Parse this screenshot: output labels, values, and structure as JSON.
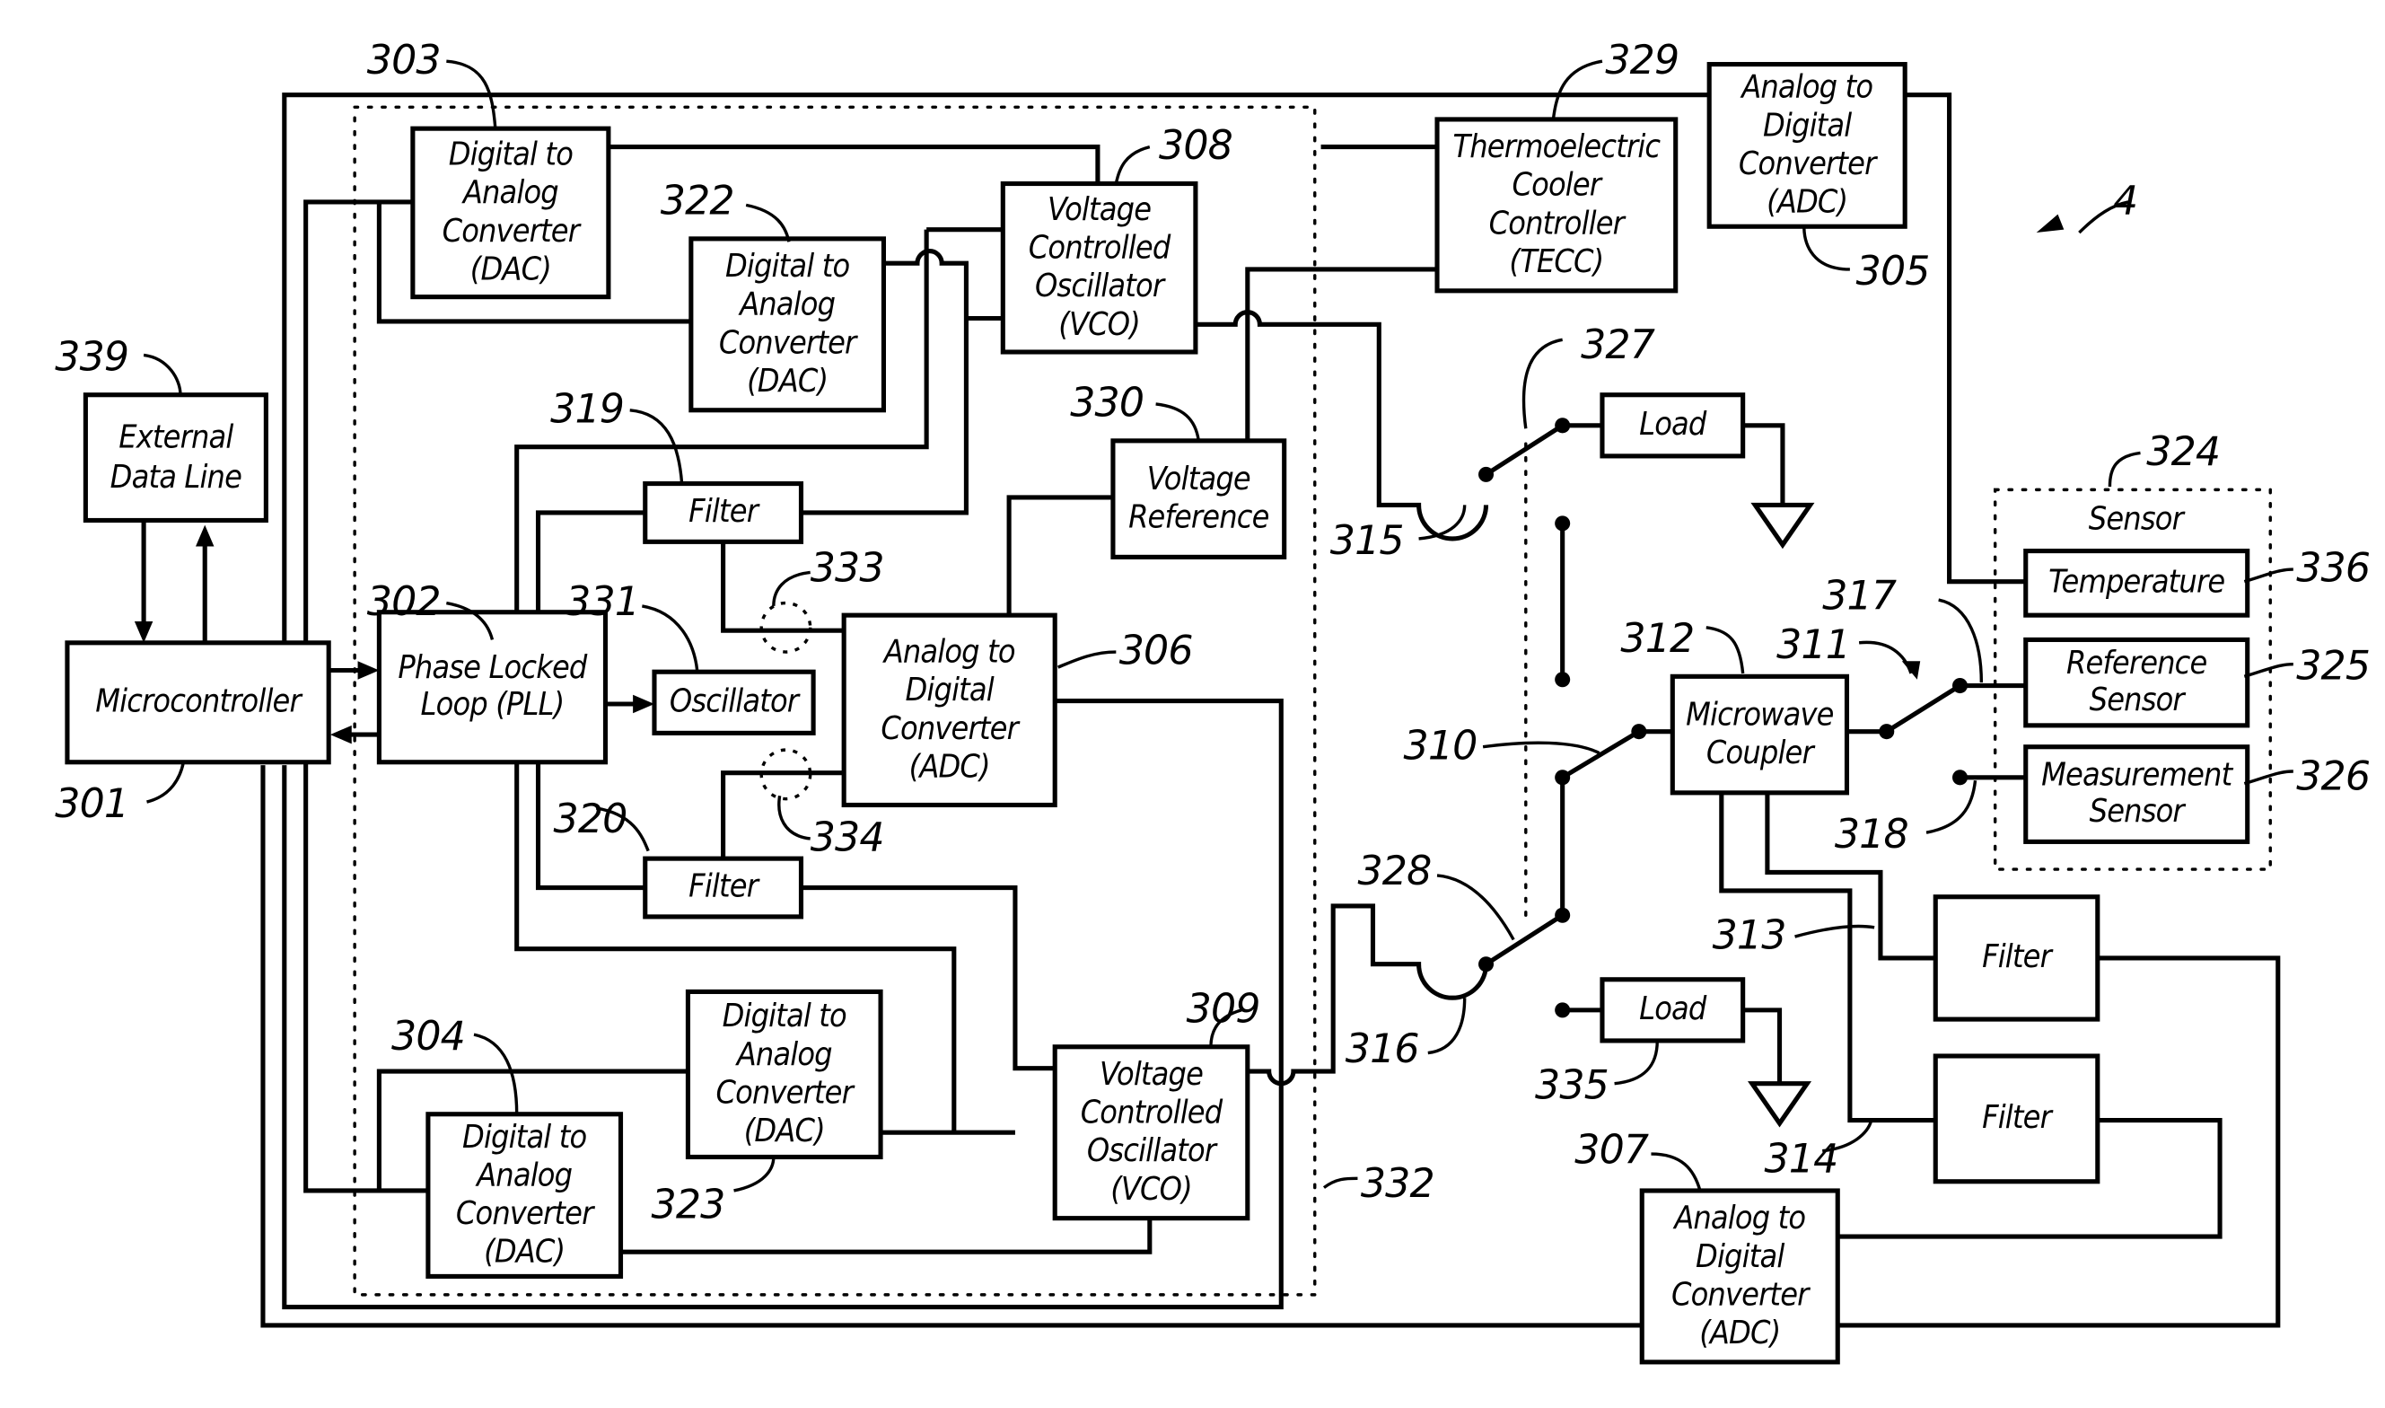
{
  "figure": {
    "figure_number": "4",
    "blocks": {
      "microcontroller": {
        "ref": "301",
        "lines": [
          "Microcontroller"
        ]
      },
      "pll": {
        "ref": "302",
        "lines": [
          "Phase Locked",
          "Loop (PLL)"
        ]
      },
      "dac_303": {
        "ref": "303",
        "lines": [
          "Digital to",
          "Analog",
          "Converter",
          "(DAC)"
        ]
      },
      "dac_322": {
        "ref": "322",
        "lines": [
          "Digital to",
          "Analog",
          "Converter",
          "(DAC)"
        ]
      },
      "dac_304": {
        "ref": "304",
        "lines": [
          "Digital to",
          "Analog",
          "Converter",
          "(DAC)"
        ]
      },
      "dac_323": {
        "ref": "323",
        "lines": [
          "Digital to",
          "Analog",
          "Converter",
          "(DAC)"
        ]
      },
      "vco_308": {
        "ref": "308",
        "lines": [
          "Voltage",
          "Controlled",
          "Oscillator",
          "(VCO)"
        ]
      },
      "vco_309": {
        "ref": "309",
        "lines": [
          "Voltage",
          "Controlled",
          "Oscillator",
          "(VCO)"
        ]
      },
      "filter_319": {
        "ref": "319",
        "lines": [
          "Filter"
        ]
      },
      "filter_320": {
        "ref": "320",
        "lines": [
          "Filter"
        ]
      },
      "oscillator": {
        "ref": "331",
        "lines": [
          "Oscillator"
        ]
      },
      "adc_306": {
        "ref": "306",
        "lines": [
          "Analog to",
          "Digital",
          "Converter",
          "(ADC)"
        ]
      },
      "voltage_reference": {
        "ref": "330",
        "lines": [
          "Voltage",
          "Reference"
        ]
      },
      "tecc": {
        "ref": "329",
        "lines": [
          "Thermoelectric",
          "Cooler",
          "Controller",
          "(TECC)"
        ]
      },
      "adc_305": {
        "ref": "305",
        "lines": [
          "Analog to",
          "Digital",
          "Converter",
          "(ADC)"
        ]
      },
      "external_data_line": {
        "ref": "339",
        "lines": [
          "External",
          "Data Line"
        ]
      },
      "load_top": {
        "ref": "",
        "lines": [
          "Load"
        ]
      },
      "load_bottom": {
        "ref": "335",
        "lines": [
          "Load"
        ]
      },
      "microwave_coupler": {
        "ref": "312",
        "lines": [
          "Microwave",
          "Coupler"
        ]
      },
      "filter_313": {
        "ref": "313",
        "lines": [
          "Filter"
        ]
      },
      "filter_314": {
        "ref": "314",
        "lines": [
          "Filter"
        ]
      },
      "adc_307": {
        "ref": "307",
        "lines": [
          "Analog to",
          "Digital",
          "Converter",
          "(ADC)"
        ]
      },
      "sensor_group": {
        "ref": "324",
        "title": "Sensor"
      },
      "temperature": {
        "ref": "336",
        "lines": [
          "Temperature"
        ]
      },
      "reference_sensor": {
        "ref": "325",
        "lines": [
          "Reference",
          "Sensor"
        ]
      },
      "measurement_sensor": {
        "ref": "326",
        "lines": [
          "Measurement",
          "Sensor"
        ]
      }
    },
    "callouts": {
      "module_boundary": "332",
      "switch_310": "310",
      "switch_311": "311",
      "node_315": "315",
      "node_316": "316",
      "node_317": "317",
      "node_318": "318",
      "switch_327": "327",
      "switch_328": "328",
      "probe_333": "333",
      "probe_334": "334"
    }
  }
}
